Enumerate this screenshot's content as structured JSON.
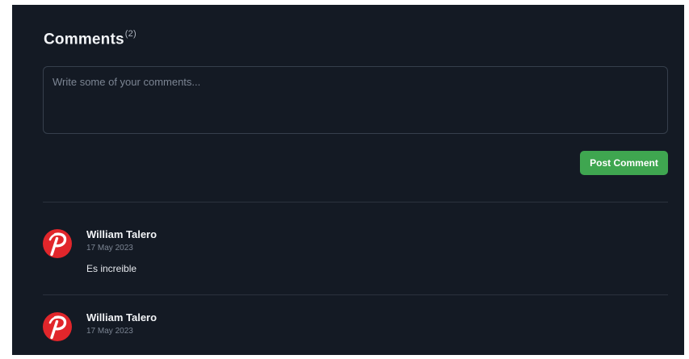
{
  "comments_section": {
    "title": "Comments",
    "count": "(2)",
    "input_placeholder": "Write some of your comments...",
    "input_value": "",
    "post_button_label": "Post Comment"
  },
  "comments": [
    {
      "author": "William Talero",
      "date": "17 May 2023",
      "text": "Es increible",
      "avatar_icon": "pinterest-logo-icon"
    },
    {
      "author": "William Talero",
      "date": "17 May 2023",
      "text": "",
      "avatar_icon": "pinterest-logo-icon"
    }
  ],
  "colors": {
    "panel_background": "#141a24",
    "post_button": "#3fa650",
    "avatar_background": "#e1262b"
  }
}
